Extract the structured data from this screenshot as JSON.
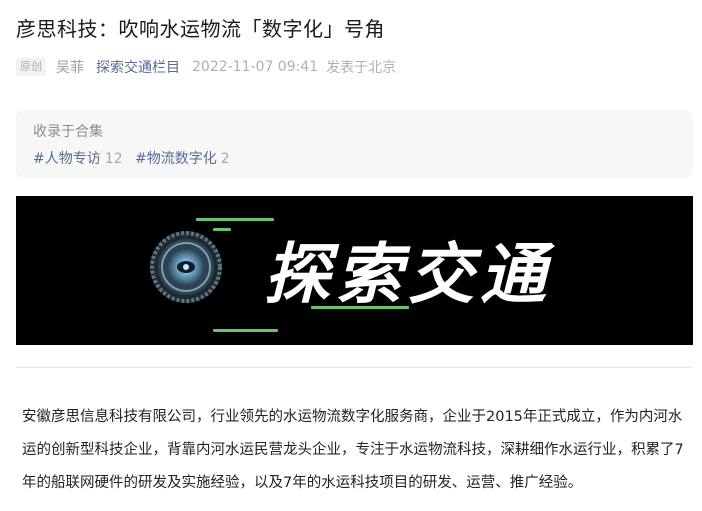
{
  "article": {
    "title": "彦思科技：吹响水运物流「数字化」号角",
    "meta": {
      "badge": "原创",
      "author": "吴菲",
      "account": "探索交通栏目",
      "datetime": "2022-11-07 09:41",
      "location": "发表于北京"
    },
    "collection": {
      "heading": "收录于合集",
      "tags": [
        {
          "label": "#人物专访",
          "count": "12"
        },
        {
          "label": "#物流数字化",
          "count": "2"
        }
      ]
    },
    "banner": {
      "title": "探索交通",
      "background": "#000000",
      "accent": "#6bc26b",
      "icon": "tire-logo-icon"
    },
    "body": "安徽彦思信息科技有限公司，行业领先的水运物流数字化服务商，企业于2015年正式成立，作为内河水运的创新型科技企业，背靠内河水运民营龙头企业，专注于水运物流科技，深耕细作水运行业，积累了7年的船联网硬件的研发及实施经验，以及7年的水运科技项目的研发、运营、推广经验。"
  },
  "colors": {
    "link": "#576b95",
    "muted": "#b0b0b0",
    "panel": "#f7f7f7"
  }
}
